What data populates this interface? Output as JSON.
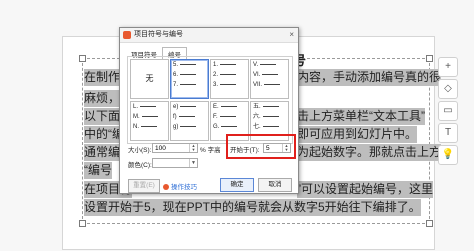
{
  "slide": {
    "title": "号",
    "lines": [
      "在制作P",
      "麻烦，该",
      "以下面这",
      "中的“编",
      "通常编号",
      "“编号",
      "在项目符",
      "设置开始于5，现在PPT中的编号就会从数字5开始往下编排了。"
    ],
    "right_fragments": [
      "内容，手动添加编号真的很",
      "击上方菜单栏“文本工具”",
      "即可应用到幻灯片中。",
      "为起始数字。那就点击上方",
      "”可以设置起始编号，这里"
    ]
  },
  "tools": [
    "+",
    "◇",
    "▭",
    "T",
    "💡"
  ],
  "dialog": {
    "title": "项目符号与编号",
    "close": "×",
    "tabs": [
      "项目符号",
      "编号"
    ],
    "active_tab": "编号",
    "grid": [
      {
        "type": "none",
        "label": "无"
      },
      {
        "type": "list",
        "items": [
          "5.",
          "6.",
          "7."
        ],
        "selected": true
      },
      {
        "type": "list",
        "items": [
          "1.",
          "2.",
          "3."
        ]
      },
      {
        "type": "list",
        "items": [
          "V.",
          "VI.",
          "VII."
        ]
      },
      {
        "type": "list",
        "items": [
          "L.",
          "M.",
          "N."
        ]
      },
      {
        "type": "list",
        "items": [
          "e)",
          "f)",
          "g)"
        ]
      },
      {
        "type": "list",
        "items": [
          "E.",
          "F.",
          "G."
        ]
      },
      {
        "type": "list",
        "items": [
          "五.",
          "六.",
          "七."
        ]
      }
    ],
    "size_label": "大小(S):",
    "size_value": "100",
    "size_unit": "% 字高",
    "start_label": "开始于(T):",
    "start_value": "5",
    "color_label": "颜色(C):",
    "reset_label": "重置(E)",
    "tips_label": "操作技巧",
    "ok_label": "确定",
    "cancel_label": "取消"
  }
}
